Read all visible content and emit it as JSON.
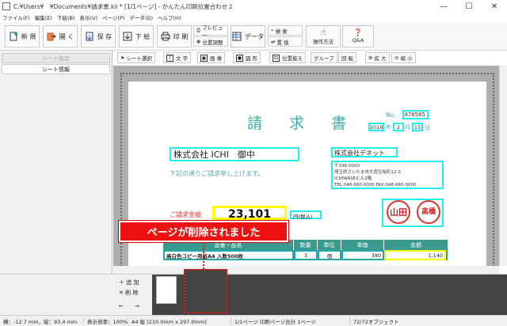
{
  "window": {
    "title": "C:¥Users¥　¥Documents¥請求書.kii * [1/1ページ] - かんたん印刷位置合わせ２",
    "min": "—",
    "max": "☐",
    "close": "✕"
  },
  "menu": [
    "ファイル(F)",
    "編集(E)",
    "下絵(B)",
    "表示(V)",
    "ページ(P)",
    "データ(D)",
    "ヘルプ(H)"
  ],
  "toolbar": {
    "new": "新 規",
    "open": "開 く",
    "save": "保 存",
    "shita": "下 絵",
    "print": "印 刷",
    "preview": "プレビュー",
    "align": "位置調整",
    "data": "データ",
    "search": "検 索",
    "replace": "置 換",
    "howto": "操作方法",
    "qa": "Q&A"
  },
  "sidebar": {
    "tab1": "シート設定",
    "tab2": "シート情報"
  },
  "pagetools": [
    "シート選択",
    "文 字",
    "画 像",
    "図 形",
    "位置揃え",
    "グループ",
    "回 転",
    "拡 大",
    "縮 小"
  ],
  "invoice": {
    "title": "請 求 書",
    "no_label": "No.",
    "no_value": "478565",
    "date_year": "2016",
    "date_nen": "年",
    "date_month": "2",
    "date_gatsu": "月",
    "date_day": "15",
    "date_nichi": "日",
    "customer": "株式会社 ICHI　御中",
    "request_text": "下記の通りご請求申し上げます。",
    "company": "株式会社デネット",
    "address1": "〒336-0000",
    "address2": "埼玉県さいたま市大宮区桜町12-3",
    "address3": "ICHIWASEビル2階",
    "tel": "TEL:048-660-0000  FAX:048-660-0000",
    "amount_label": "ご請求金額",
    "amount": "23,101",
    "tax_label": "円(税込)",
    "stamp1": "山田",
    "stamp2": "高橋",
    "headers": [
      "品番・品名",
      "数量",
      "単位",
      "単価",
      "金額"
    ],
    "row": {
      "name": "高白色コピー用紙A4 入数500枚",
      "qty": "3",
      "unit": "個",
      "price": "380",
      "amount": "1,140"
    }
  },
  "callout": "ページが削除されました",
  "pagepanel": {
    "add": "追 加",
    "delete": "削 除",
    "prev": "←",
    "next": "→"
  },
  "status": [
    "横：-12.7 mm，縦：93.4 mm",
    "表示倍率：100%",
    "A4 縦 [210.0mm x 297.0mm]",
    "1/1ページ 印刷ページ合計 1ページ",
    "72/72オブジェクト"
  ]
}
